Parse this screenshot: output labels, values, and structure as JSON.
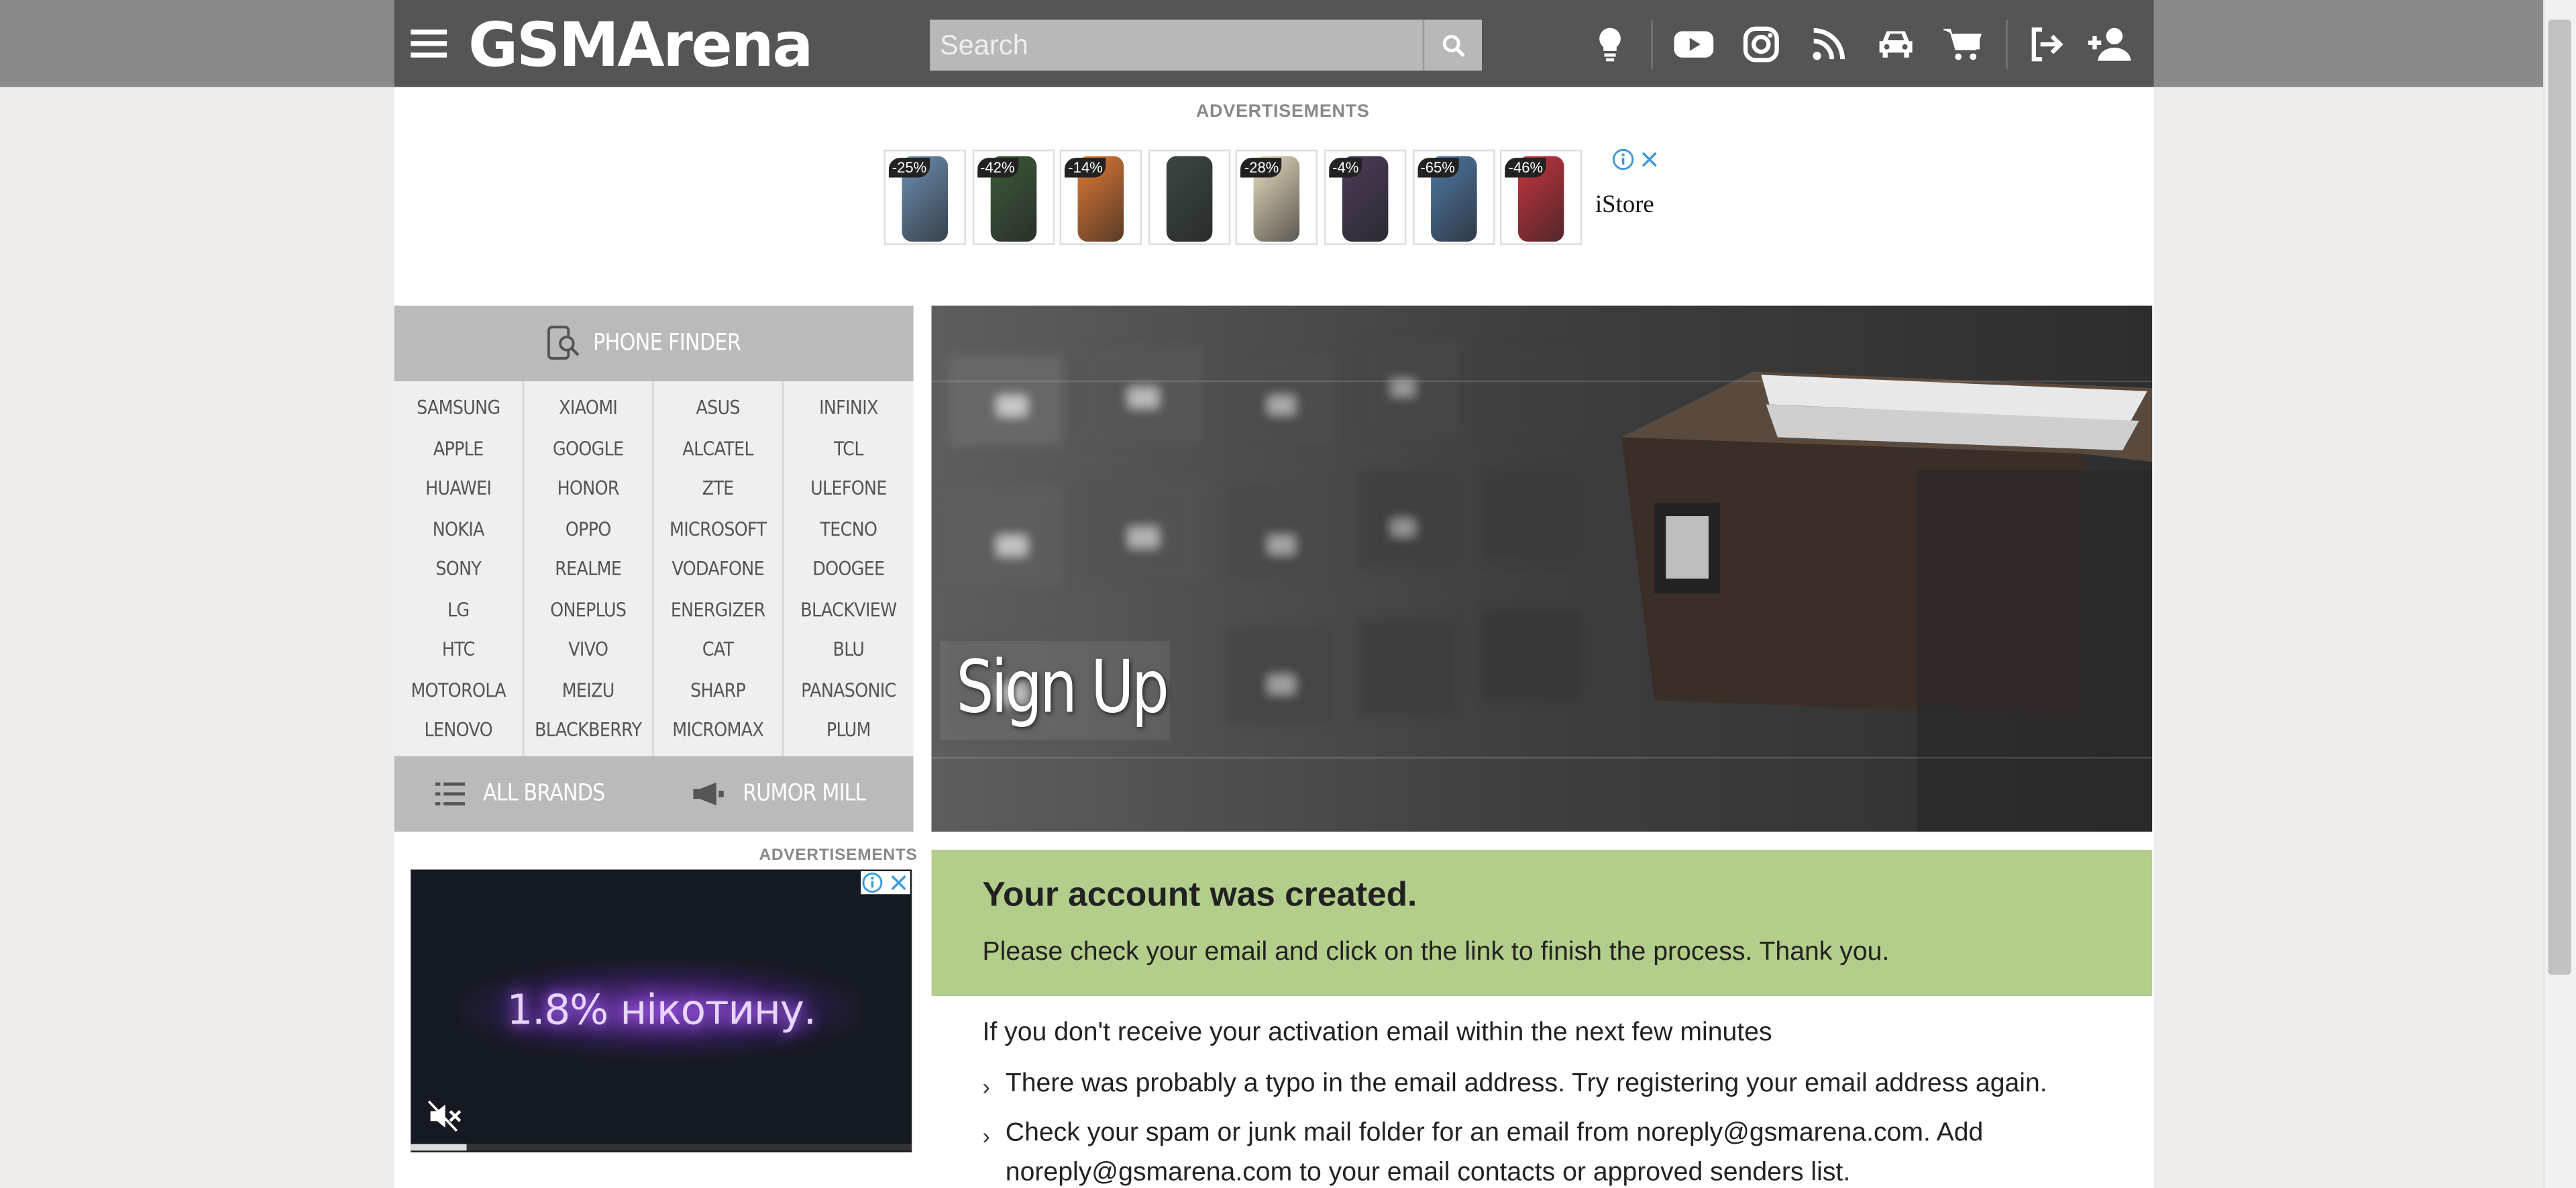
{
  "header": {
    "logo_text": "GSMArena",
    "search_placeholder": "Search",
    "icons": [
      "menu-icon",
      "lightbulb-icon",
      "youtube-icon",
      "instagram-icon",
      "rss-icon",
      "car-icon",
      "cart-icon",
      "login-icon",
      "add-user-icon"
    ]
  },
  "top_ad": {
    "label": "ADVERTISEMENTS",
    "items": [
      {
        "discount": "-25%",
        "color": "#6d8fb3"
      },
      {
        "discount": "-42%",
        "color": "#3d5a3a"
      },
      {
        "discount": "-14%",
        "color": "#e07a35"
      },
      {
        "discount": "",
        "color": "#3b4744"
      },
      {
        "discount": "-28%",
        "color": "#e9dcc0"
      },
      {
        "discount": "-4%",
        "color": "#4a3c58"
      },
      {
        "discount": "-65%",
        "color": "#4f78a3"
      },
      {
        "discount": "-46%",
        "color": "#c8343f"
      }
    ],
    "brand": "iStore"
  },
  "sidebar": {
    "title": "PHONE FINDER",
    "brand_columns": [
      [
        "SAMSUNG",
        "APPLE",
        "HUAWEI",
        "NOKIA",
        "SONY",
        "LG",
        "HTC",
        "MOTOROLA",
        "LENOVO"
      ],
      [
        "XIAOMI",
        "GOOGLE",
        "HONOR",
        "OPPO",
        "REALME",
        "ONEPLUS",
        "VIVO",
        "MEIZU",
        "BLACKBERRY"
      ],
      [
        "ASUS",
        "ALCATEL",
        "ZTE",
        "MICROSOFT",
        "VODAFONE",
        "ENERGIZER",
        "CAT",
        "SHARP",
        "MICROMAX"
      ],
      [
        "INFINIX",
        "TCL",
        "ULEFONE",
        "TECNO",
        "DOOGEE",
        "BLACKVIEW",
        "BLU",
        "PANASONIC",
        "PLUM"
      ]
    ],
    "all_brands": "ALL BRANDS",
    "rumor_mill": "RUMOR MILL"
  },
  "side_ad": {
    "label": "ADVERTISEMENTS",
    "text": "1.8% нікотину."
  },
  "hero": {
    "title": "Sign Up"
  },
  "success": {
    "heading": "Your account was created.",
    "message": "Please check your email and click on the link to finish the process. Thank you."
  },
  "info": {
    "intro": "If you don't receive your activation email within the next few minutes",
    "bullet1": "There was probably a typo in the email address. Try registering your email address again.",
    "bullet2_line1": "Check your spam or junk mail folder for an email from noreply@gsmarena.com. Add",
    "bullet2_line2": "noreply@gsmarena.com to your email contacts or approved senders list."
  },
  "colors": {
    "header": "#555555",
    "success_bg": "#b3cd8b",
    "sidebar": "#bababa"
  }
}
